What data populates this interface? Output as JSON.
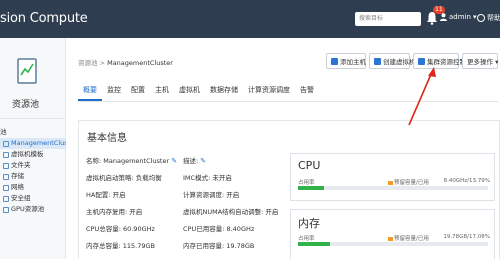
{
  "header": {
    "brand": "sion Compute",
    "search_placeholder": "搜索目标",
    "notification_count": "11",
    "user": "admin",
    "help": "帮助"
  },
  "sidebar": {
    "title": "资源池",
    "root_label": "池",
    "items": [
      {
        "label": "ManagementCluster",
        "active": true
      },
      {
        "label": "虚拟机模板"
      },
      {
        "label": "文件夹"
      },
      {
        "label": "存储"
      },
      {
        "label": "网络"
      },
      {
        "label": "安全组"
      },
      {
        "label": "GPU资源池"
      }
    ]
  },
  "breadcrumb": {
    "root": "资源池",
    "sep": " > ",
    "current": "ManagementCluster"
  },
  "toolbar": {
    "buttons": [
      "添加主机",
      "创建虚拟机",
      "集群资源控制",
      "更多操作 ▾"
    ]
  },
  "tabs": [
    "概要",
    "监控",
    "配置",
    "主机",
    "虚拟机",
    "数据存储",
    "计算资源调度",
    "告警"
  ],
  "basic_info": {
    "title": "基本信息",
    "left": [
      "名称: ManagementCluster",
      "虚拟机启动策略: 负载均衡",
      "HA配置: 开启",
      "主机内存复用: 开启",
      "CPU总容量: 60.90GHz",
      "内存总容量: 115.79GB"
    ],
    "right": [
      "描述:",
      "IMC模式: 未开启",
      "计算资源调度: 开启",
      "虚拟机NUMA结构自动调整: 开启",
      "CPU已用容量: 8.40GHz",
      "内存已用容量: 19.78GB"
    ]
  },
  "cpu": {
    "title": "CPU",
    "label_rate": "占用率",
    "label_warn": "预留容量/已用",
    "value": "8.40GHz/13.79%",
    "used_percent": 13.79,
    "colors": {
      "used": "#2fb34a",
      "reserve": "#f29b21"
    }
  },
  "memory": {
    "title": "内存",
    "label_rate": "占用率",
    "label_warn": "预留容量/已用",
    "value": "19.78GB/17.08%",
    "used_percent": 17.08,
    "colors": {
      "used": "#2fb34a",
      "reserve": "#f29b21"
    }
  }
}
